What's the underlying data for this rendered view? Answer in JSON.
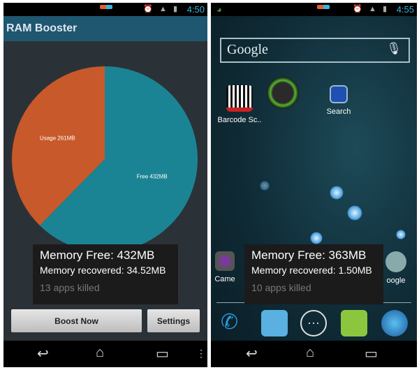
{
  "left": {
    "status": {
      "time": "4:50"
    },
    "app_title": "RAM Booster",
    "chart_data": {
      "type": "pie",
      "categories": [
        "Usage",
        "Free"
      ],
      "values": [
        261,
        432
      ],
      "labels": [
        "Usage 261MB",
        "Free 432MB"
      ],
      "colors": [
        "#c8592a",
        "#1b8494"
      ]
    },
    "toast": {
      "memory_free": "Memory Free: 432MB",
      "memory_recovered": "Memory recovered: 34.52MB",
      "apps_killed": "13 apps killed"
    },
    "buttons": {
      "boost": "Boost Now",
      "settings": "Settings"
    }
  },
  "right": {
    "status": {
      "time": "4:55"
    },
    "search": {
      "placeholder": "Google"
    },
    "apps": [
      {
        "label": "Barcode Sc.."
      },
      {
        "label": ""
      },
      {
        "label": "Search"
      },
      {
        "label": "Came"
      },
      {
        "label": "oogle"
      }
    ],
    "toast": {
      "memory_free": "Memory Free: 363MB",
      "memory_recovered": "Memory recovered: 1.50MB",
      "apps_killed": "10 apps killed"
    }
  }
}
